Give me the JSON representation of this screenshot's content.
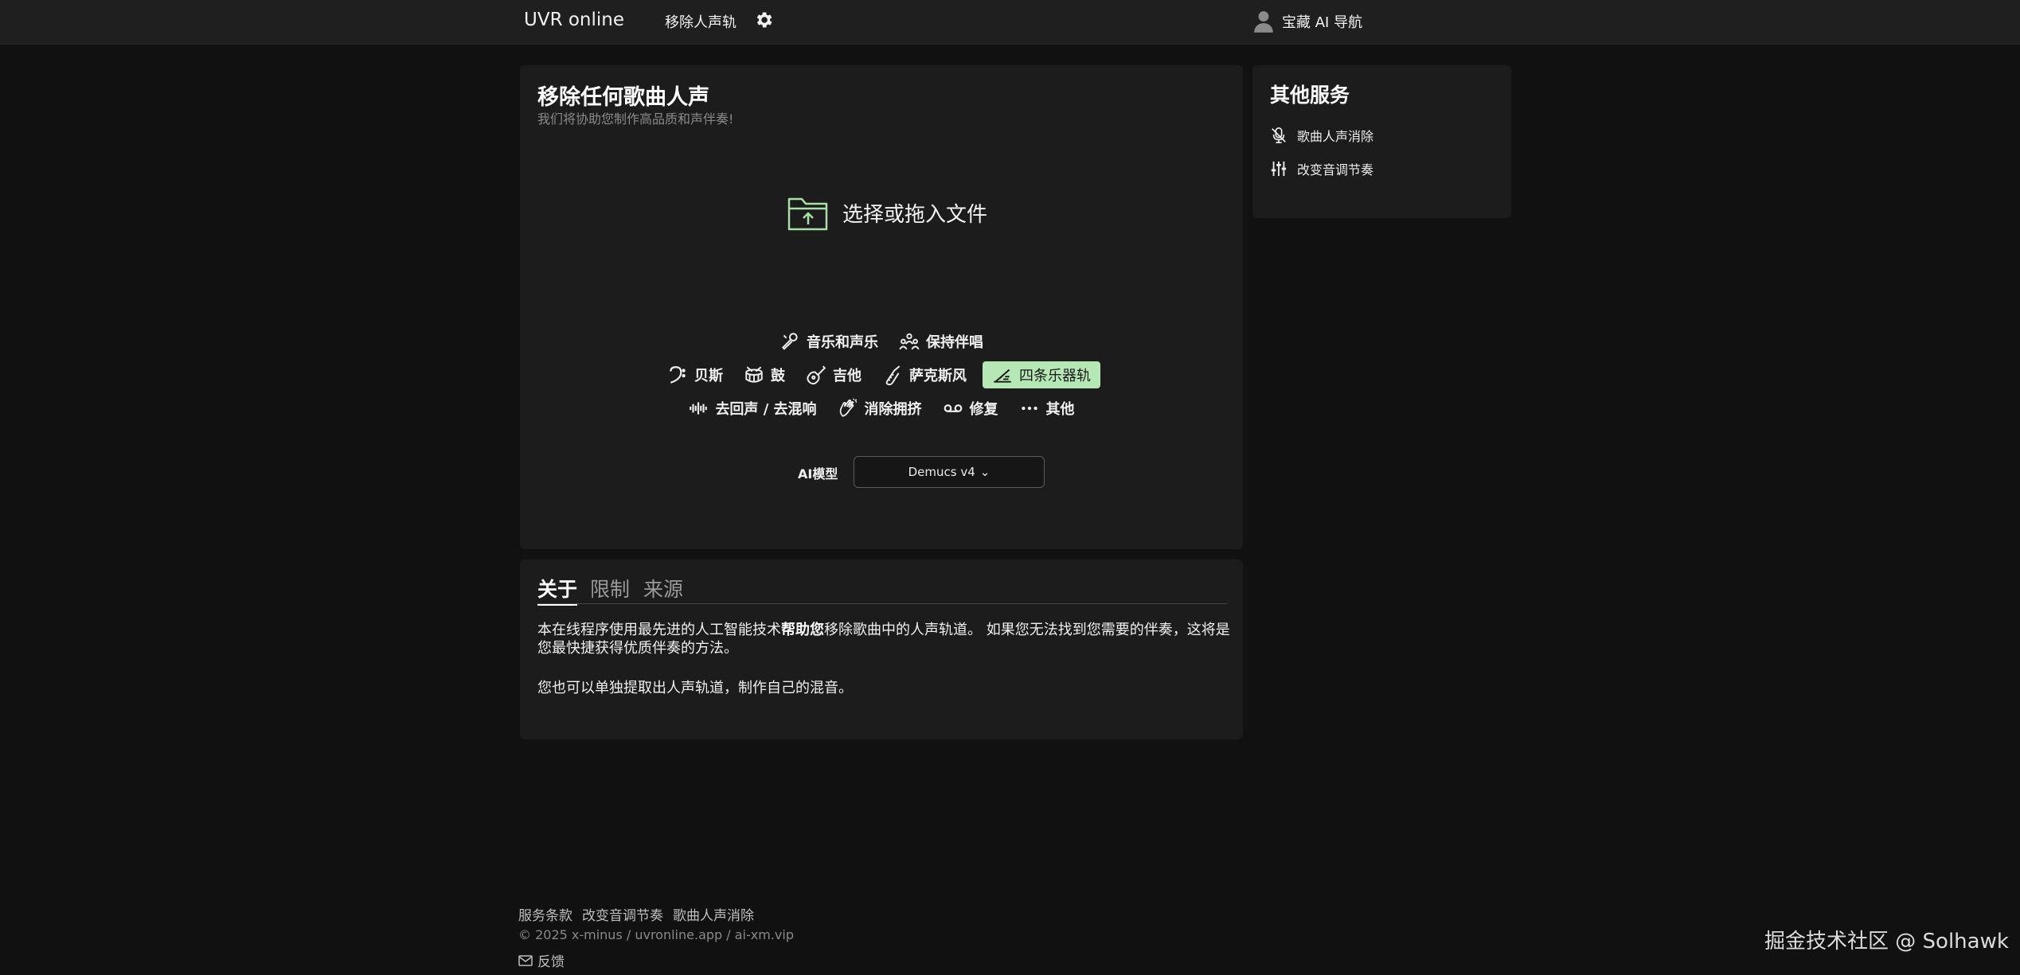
{
  "header": {
    "brand": "UVR online",
    "nav_link": "移除人声轨",
    "user_label": "宝藏 AI 导航"
  },
  "main": {
    "title": "移除任何歌曲人声",
    "subtitle": "我们将协助您制作高品质和声伴奏!",
    "upload_label": "选择或拖入文件",
    "options_row1": [
      "音乐和声乐",
      "保持伴唱"
    ],
    "options_row2": [
      "贝斯",
      "鼓",
      "吉他",
      "萨克斯风",
      "四条乐器轨"
    ],
    "options_row3": [
      "去回声 / 去混响",
      "消除拥挤",
      "修复",
      "其他"
    ],
    "active_option": "四条乐器轨",
    "model_label": "AI模型",
    "model_value": "Demucs v4"
  },
  "side": {
    "title": "其他服务",
    "items": [
      "歌曲人声消除",
      "改变音调节奏"
    ]
  },
  "about": {
    "tabs": [
      "关于",
      "限制",
      "来源"
    ],
    "text_before_bold": "本在线程序使用最先进的人工智能技术",
    "text_bold": "帮助您",
    "text_after_bold": "移除歌曲中的人声轨道。 如果您无法找到您需要的伴奏，这将是您最快捷获得优质伴奏的方法。",
    "paragraph2": "您也可以单独提取出人声轨道，制作自己的混音。"
  },
  "footer": {
    "links": [
      "服务条款",
      "改变音调节奏",
      "歌曲人声消除"
    ],
    "copyright": "© 2025 x-minus / uvronline.app / ai-xm.vip",
    "feedback": "反馈"
  },
  "watermark": "掘金技术社区 @ Solhawk",
  "colors": {
    "background": "#111111",
    "card": "#1c1c1c",
    "accent": "#b5e8b5",
    "upload_icon": "#a8e0a8"
  }
}
